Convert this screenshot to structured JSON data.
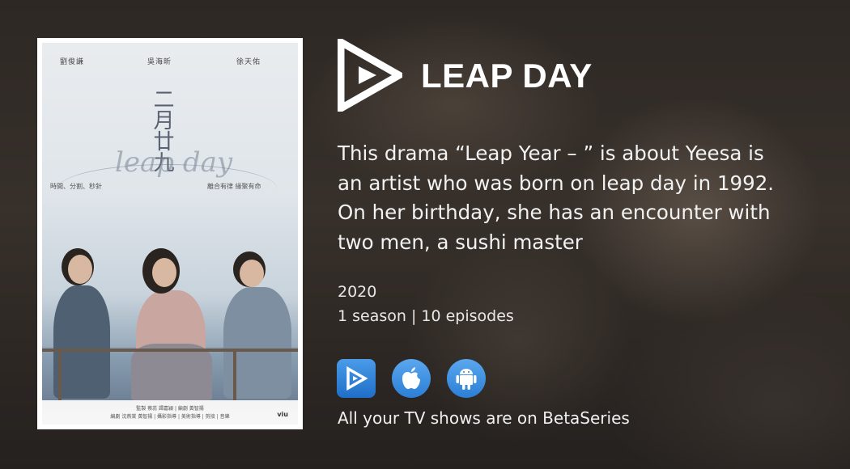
{
  "show": {
    "title": "LEAP DAY",
    "description": "This drama “Leap Year –        ” is about Yeesa is an artist who was born on leap day in 1992. On her birthday, she has an encounter with two men, a sushi master",
    "year": "2020",
    "seasons_episodes": "1 season | 10 episodes"
  },
  "poster": {
    "title_cjk": "二月廿九",
    "script_title": "leap day",
    "cast": [
      "劉俊謙",
      "吳海昕",
      "徐天佑"
    ],
    "tag_left": "時間、分割、秒針",
    "tag_right": "離合有律 緣聚有命",
    "credits_line1": "監製 蔡蕊 譚嘉穎 | 編劇 黃智揚",
    "credits_line2": "編劇 沈燕棠 黃智揚 | 攝影指導 | 美術指導 | 剪接 | 音樂",
    "brand": "viu"
  },
  "stores": [
    {
      "name": "BetaSeries",
      "icon": "betaseries-play-icon"
    },
    {
      "name": "App Store",
      "icon": "apple-icon"
    },
    {
      "name": "Google Play",
      "icon": "android-icon"
    }
  ],
  "footer": {
    "tagline": "All your TV shows are on BetaSeries"
  },
  "colors": {
    "accent": "#2c7fd6",
    "text": "#f4f4f4"
  }
}
